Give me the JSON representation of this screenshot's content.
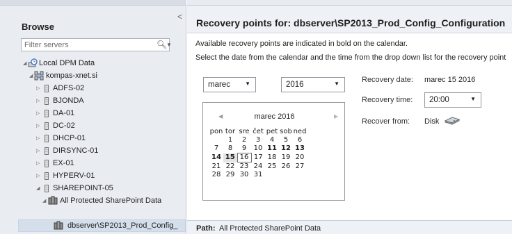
{
  "sidebar": {
    "title": "Browse",
    "filter_placeholder": "Filter servers",
    "collapse_glyph": "<",
    "tree": {
      "root": "Local DPM Data",
      "domain": "kompas-xnet.si",
      "servers": [
        "ADFS-02",
        "BJONDA",
        "DA-01",
        "DC-02",
        "DHCP-01",
        "DIRSYNC-01",
        "EX-01",
        "HYPERV-01",
        "SHAREPOINT-05"
      ],
      "group": "All Protected SharePoint Data",
      "selected_item": "dbserver\\SP2013_Prod_Config_"
    }
  },
  "main": {
    "title": "Recovery points for:  dbserver\\SP2013_Prod_Config_Configuration",
    "info_line1": "Available recovery points are indicated in bold on the calendar.",
    "info_line2": "Select the date from the calendar and the time from the drop down list for the recovery point",
    "month_select": "marec",
    "year_select": "2016",
    "calendar": {
      "header": "marec 2016",
      "day_names": [
        "pon",
        "tor",
        "sre",
        "čet",
        "pet",
        "sob",
        "ned"
      ],
      "weeks": [
        [
          "",
          "1",
          "2",
          "3",
          "4",
          "5",
          "6"
        ],
        [
          "7",
          "8",
          "9",
          "10",
          "11",
          "12",
          "13"
        ],
        [
          "14",
          "15",
          "16",
          "17",
          "18",
          "19",
          "20"
        ],
        [
          "21",
          "22",
          "23",
          "24",
          "25",
          "26",
          "27"
        ],
        [
          "28",
          "29",
          "30",
          "31",
          "",
          "",
          ""
        ]
      ],
      "bold_days": [
        "11",
        "12",
        "13",
        "14",
        "15"
      ],
      "selected_day": "15",
      "today_day": "16"
    },
    "recovery_date_label": "Recovery date:",
    "recovery_date_value": "marec 15 2016",
    "recovery_time_label": "Recovery time:",
    "recovery_time_value": "20:00",
    "recover_from_label": "Recover from:",
    "recover_from_value": "Disk",
    "path_label": "Path:",
    "path_value": "All Protected SharePoint Data"
  },
  "colors": {
    "left_pane_bg": "#e9ecf1",
    "header_bg": "#eef1f5",
    "selected_row": "#d5dfec"
  },
  "icons": [
    "search-icon",
    "dropdown-arrow-icon",
    "tree-expand-icon",
    "tree-collapse-icon",
    "server-icon",
    "domain-icon",
    "local-data-icon",
    "sharepoint-farm-icon",
    "disk-icon"
  ]
}
